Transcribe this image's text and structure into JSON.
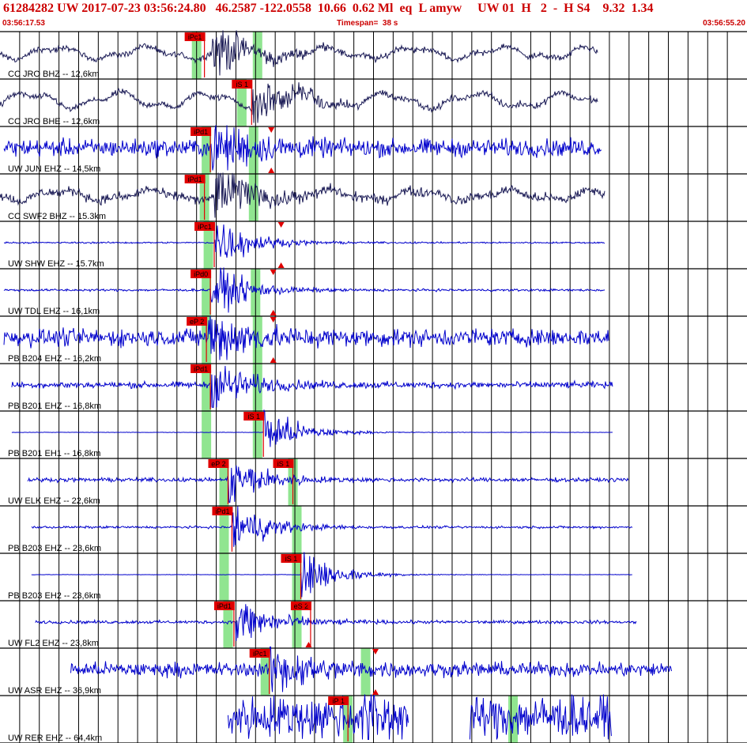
{
  "header": {
    "title": "61284282 UW 2017-07-23 03:56:24.80   46.2587 -122.0558  10.66  0.62 Ml  eq  L amyw     UW 01  H   2  -  H S4    9.32  1.34",
    "start_time": "03:56:17.53",
    "timespan": "Timespan=  38 s",
    "end_time": "03:56:55.20"
  },
  "chart_data": {
    "type": "line",
    "title": "61284282 UW 2017-07-23 03:56:24.80   46.2587 -122.0558  10.66  0.62 Ml  eq  L amyw     UW 01  H   2  -  H S4    9.32  1.34",
    "x_range_seconds": [
      0,
      38
    ],
    "x_label": "Timespan=  38 s",
    "grid": true,
    "traces": [
      {
        "label": "CC JRO BHZ -- 12,6km",
        "color": "#1a1a55",
        "kind": "bb",
        "start": 0,
        "end": 30.4,
        "amp": 0.35,
        "noise": 0.08,
        "arrival": 10.8,
        "picks": [
          {
            "label": "iPc1",
            "t": 10.4,
            "phase": "P"
          }
        ],
        "windows": [
          10.0,
          13.1
        ]
      },
      {
        "label": "CC JRO BHE -- 12,6km",
        "color": "#1a1a55",
        "kind": "bb",
        "start": 0,
        "end": 30.4,
        "amp": 0.45,
        "noise": 0.08,
        "arrival": 12.8,
        "picks": [
          {
            "label": "iS 1",
            "t": 12.8,
            "phase": "S"
          }
        ],
        "windows": [
          12.3
        ]
      },
      {
        "label": "UW JUN EHZ -- 14,5km",
        "color": "#0000cc",
        "kind": "sp",
        "start": 0.2,
        "end": 30.6,
        "amp": 0.25,
        "noise": 0.22,
        "arrival": 10.8,
        "picks": [
          {
            "label": "iPd1",
            "t": 10.7,
            "phase": "P"
          }
        ],
        "windows": [
          10.5,
          12.9
        ],
        "triangles": [
          13.8
        ]
      },
      {
        "label": "CC SWF2 BHZ -- 15.3km",
        "color": "#1a1a55",
        "kind": "bb",
        "start": 0,
        "end": 30.8,
        "amp": 0.3,
        "noise": 0.12,
        "arrival": 10.9,
        "picks": [
          {
            "label": "iPd1",
            "t": 10.4,
            "phase": "P"
          }
        ],
        "windows": [
          10.4,
          12.9
        ]
      },
      {
        "label": "UW SHW EHZ -- 15.7km",
        "color": "#0000cc",
        "kind": "sp",
        "start": 0.2,
        "end": 30.8,
        "amp": 0.0,
        "noise": 0.02,
        "arrival": 10.9,
        "picks": [
          {
            "label": "iPc1",
            "t": 10.9,
            "phase": "P"
          }
        ],
        "windows": [
          10.6
        ],
        "triangles": [
          14.3
        ]
      },
      {
        "label": "UW TDL EHZ -- 16,1km",
        "color": "#0000cc",
        "kind": "sp",
        "start": 0.2,
        "end": 30.8,
        "amp": 0.0,
        "noise": 0.03,
        "arrival": 10.7,
        "picks": [
          {
            "label": "iPd0",
            "t": 10.7,
            "phase": "P"
          }
        ],
        "windows": [
          10.5,
          13.0
        ],
        "triangles": [
          13.9
        ]
      },
      {
        "label": "PB B204 EHZ -- 16,2km",
        "color": "#0000cc",
        "kind": "sp",
        "start": 0.2,
        "end": 31.0,
        "amp": 0.0,
        "noise": 0.22,
        "arrival": 10.6,
        "picks": [
          {
            "label": "eP 2",
            "t": 10.5,
            "phase": "P"
          }
        ],
        "windows": [
          10.5,
          13.1
        ],
        "triangles": [
          13.9
        ]
      },
      {
        "label": "PB B201 EHZ -- 16,8km",
        "color": "#0000cc",
        "kind": "sp",
        "start": 0.6,
        "end": 31.2,
        "amp": 0.0,
        "noise": 0.08,
        "arrival": 10.7,
        "picks": [
          {
            "label": "iPd1",
            "t": 10.7,
            "phase": "P"
          }
        ],
        "windows": [
          10.5,
          13.1
        ]
      },
      {
        "label": "PB B201 EH1 -- 16,8km",
        "color": "#0000cc",
        "kind": "sp",
        "start": 0.6,
        "end": 31.2,
        "amp": 0.0,
        "noise": 0.005,
        "arrival": 13.4,
        "picks": [
          {
            "label": "iS 1",
            "t": 13.4,
            "phase": "S"
          }
        ],
        "windows": [
          10.5,
          13.1
        ]
      },
      {
        "label": "UW ELK EHZ -- 22,6km",
        "color": "#0000cc",
        "kind": "sp",
        "start": 1.4,
        "end": 32.0,
        "amp": 0.0,
        "noise": 0.05,
        "arrival": 11.6,
        "picks": [
          {
            "label": "eP 2",
            "t": 11.6,
            "phase": "P"
          },
          {
            "label": "iS 1",
            "t": 14.9,
            "phase": "S"
          }
        ],
        "windows": [
          11.4,
          14.9
        ]
      },
      {
        "label": "PB B203 EHZ -- 23,6km",
        "color": "#0000cc",
        "kind": "sp",
        "start": 1.6,
        "end": 32.2,
        "amp": 0.0,
        "noise": 0.03,
        "arrival": 11.8,
        "picks": [
          {
            "label": "iPd1",
            "t": 11.8,
            "phase": "P"
          }
        ],
        "windows": [
          11.4,
          15.1
        ]
      },
      {
        "label": "PB B203 EH2 -- 23,6km",
        "color": "#0000cc",
        "kind": "sp",
        "start": 1.6,
        "end": 32.2,
        "amp": 0.0,
        "noise": 0.005,
        "arrival": 15.3,
        "picks": [
          {
            "label": "iS 1",
            "t": 15.3,
            "phase": "S"
          }
        ],
        "windows": [
          11.4,
          15.1
        ]
      },
      {
        "label": "UW FL2 EHZ -- 23,8km",
        "color": "#0000cc",
        "kind": "sp",
        "start": 1.8,
        "end": 32.4,
        "amp": 0.0,
        "noise": 0.04,
        "arrival": 12.0,
        "picks": [
          {
            "label": "iPd1",
            "t": 11.9,
            "phase": "P"
          },
          {
            "label": "eS 2",
            "t": 15.8,
            "phase": "S"
          }
        ],
        "windows": [
          11.6,
          15.1
        ],
        "triangles": [
          15.7
        ]
      },
      {
        "label": "UW ASR EHZ -- 36,9km",
        "color": "#0000cc",
        "kind": "sp",
        "start": 3.6,
        "end": 34.2,
        "amp": 0.0,
        "noise": 0.18,
        "arrival": 13.7,
        "picks": [
          {
            "label": "iPc1",
            "t": 13.7,
            "phase": "P"
          }
        ],
        "windows": [
          13.5,
          18.6
        ],
        "triangles": [
          19.1
        ]
      },
      {
        "label": "UW RER EHZ -- 64,4km",
        "color": "#0000cc",
        "kind": "gappy",
        "segments": [
          [
            11.6,
            20.8
          ],
          [
            23.9,
            31.1
          ]
        ],
        "amp": 0.0,
        "noise": 0.55,
        "arrival": 18.3,
        "picks": [
          {
            "label": "iP 1",
            "t": 17.7,
            "phase": "P"
          }
        ],
        "windows": [
          17.7,
          26.1
        ]
      }
    ]
  }
}
